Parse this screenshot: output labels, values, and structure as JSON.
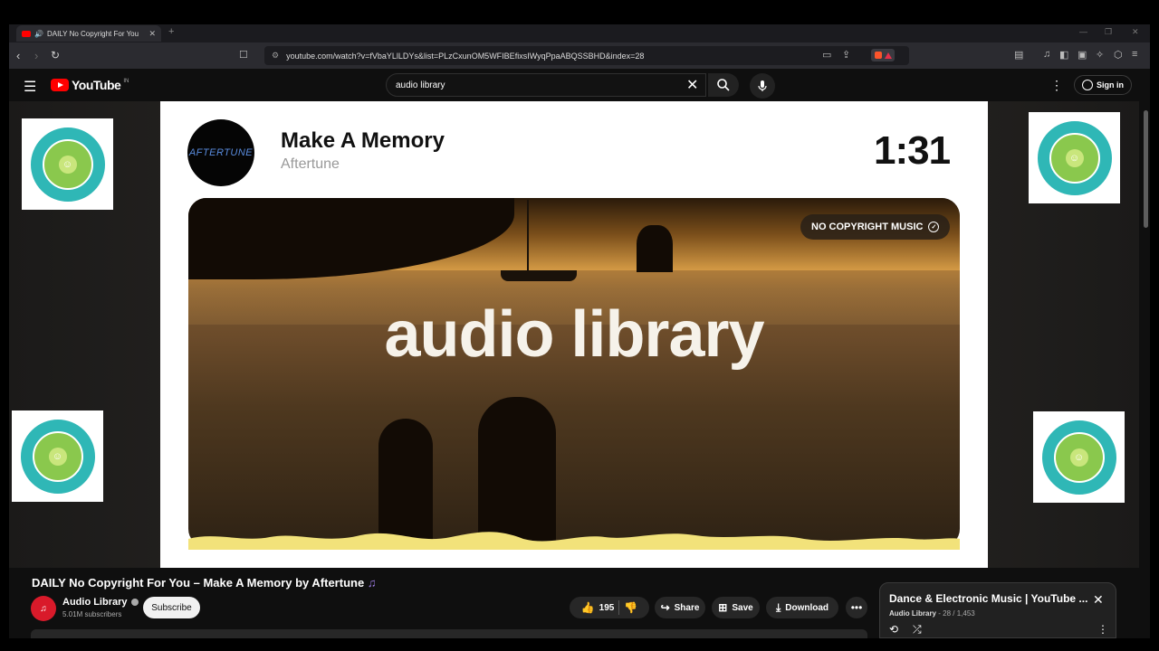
{
  "browser": {
    "tab_title": "DAILY No Copyright For You",
    "tab_close": "✕",
    "new_tab": "+",
    "url": "youtube.com/watch?v=fVbaYLlLDYs&list=PLzCxunOM5WFIBEfixsIWyqPpaABQSSBHD&index=28",
    "window_controls": [
      "—",
      "❐",
      "✕"
    ]
  },
  "masthead": {
    "logo_text": "YouTube",
    "logo_region": "IN",
    "search_value": "audio library",
    "signin_label": "Sign in"
  },
  "card": {
    "avatar_text": "AFTERTUNE",
    "track_title": "Make A Memory",
    "track_artist": "Aftertune",
    "duration": "1:31",
    "badge": "NO COPYRIGHT MUSIC",
    "brand": "audio library"
  },
  "video": {
    "title": "DAILY No Copyright For You – Make A Memory by Aftertune",
    "title_emoji": "♫",
    "channel_name": "Audio Library",
    "channel_subs": "5.01M subscribers",
    "subscribe_label": "Subscribe",
    "like_count": "195",
    "share_label": "Share",
    "save_label": "Save",
    "download_label": "Download"
  },
  "playlist": {
    "title": "Dance & Electronic Music | YouTube ...",
    "channel": "Audio Library",
    "position": "28 / 1,453"
  },
  "colors": {
    "youtube_red": "#ff0000",
    "wheel_teal": "#2fb7b6",
    "wheel_green": "#8ac84d",
    "wave_yellow": "#f2e27a"
  }
}
